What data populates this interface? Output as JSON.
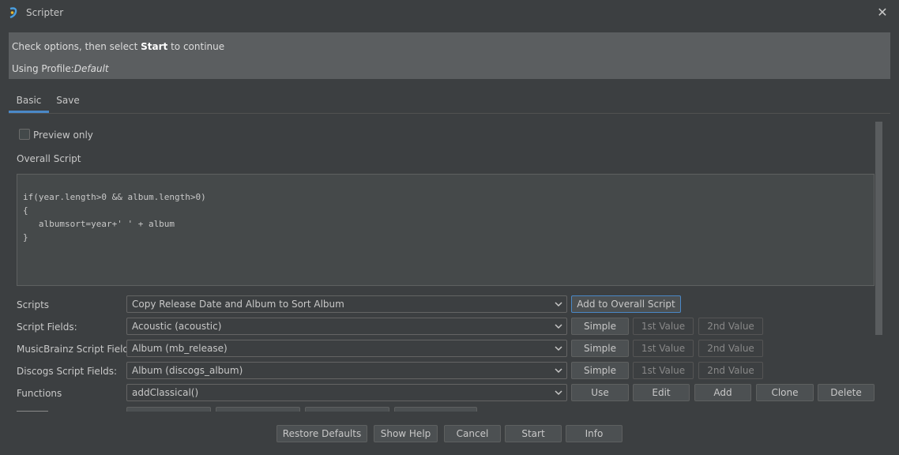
{
  "window": {
    "title": "Scripter"
  },
  "info": {
    "line1_prefix": "Check options, then select ",
    "line1_bold": "Start",
    "line1_suffix": " to continue",
    "line2_prefix": "Using Profile:",
    "line2_profile": "Default"
  },
  "tabs": [
    {
      "label": "Basic",
      "active": true
    },
    {
      "label": "Save",
      "active": false
    }
  ],
  "basic": {
    "preview_label": "Preview only",
    "preview_checked": false,
    "overall_label": "Overall Script",
    "overall_script": "if(year.length>0 && album.length>0)\n{\n   albumsort=year+' ' + album\n}",
    "rows": {
      "scripts": {
        "label": "Scripts",
        "value": "Copy Release Date and Album to Sort Album",
        "button": "Add to Overall Script"
      },
      "script_fields": {
        "label": "Script Fields:",
        "value": "Acoustic (acoustic)",
        "buttons": [
          "Simple",
          "1st Value",
          "2nd Value"
        ]
      },
      "mb_fields": {
        "label": "MusicBrainz Script Fields:",
        "value": "Album (mb_release)",
        "buttons": [
          "Simple",
          "1st Value",
          "2nd Value"
        ]
      },
      "discogs_fields": {
        "label": "Discogs Script Fields:",
        "value": "Album (discogs_album)",
        "buttons": [
          "Simple",
          "1st Value",
          "2nd Value"
        ]
      },
      "functions": {
        "label": "Functions",
        "value": "addClassical()",
        "buttons": [
          "Use",
          "Edit",
          "Add",
          "Clone",
          "Delete"
        ]
      }
    }
  },
  "footer": {
    "buttons": [
      "Restore Defaults",
      "Show Help",
      "Cancel",
      "Start",
      "Info"
    ]
  },
  "colors": {
    "accent": "#4a88c7",
    "background": "#3c3f41",
    "info_panel": "#5b5e60"
  }
}
